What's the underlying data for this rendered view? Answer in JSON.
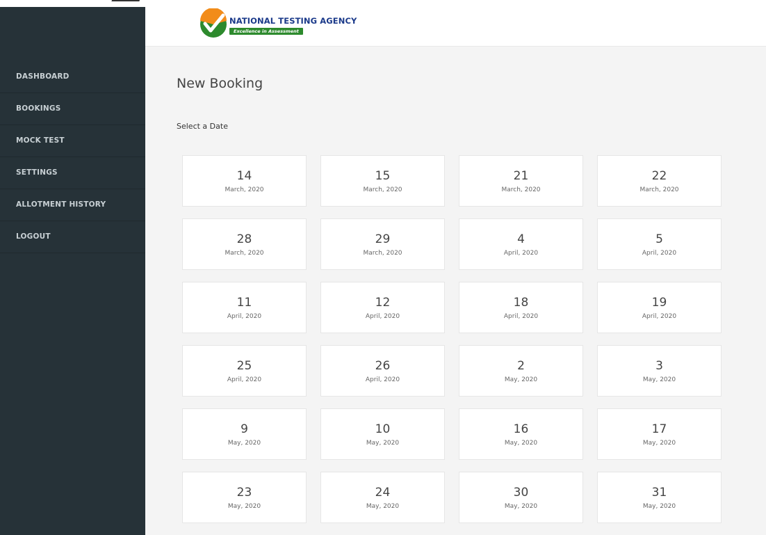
{
  "header": {
    "logo_title": "NATIONAL TESTING AGENCY",
    "logo_tagline": "Excellence in Assessment"
  },
  "sidebar": {
    "items": [
      {
        "label": "DASHBOARD"
      },
      {
        "label": "BOOKINGS"
      },
      {
        "label": "MOCK TEST"
      },
      {
        "label": "SETTINGS"
      },
      {
        "label": "ALLOTMENT HISTORY"
      },
      {
        "label": "LOGOUT"
      }
    ]
  },
  "main": {
    "title": "New Booking",
    "select_label": "Select a Date",
    "dates": [
      {
        "day": "14",
        "month": "March, 2020"
      },
      {
        "day": "15",
        "month": "March, 2020"
      },
      {
        "day": "21",
        "month": "March, 2020"
      },
      {
        "day": "22",
        "month": "March, 2020"
      },
      {
        "day": "28",
        "month": "March, 2020"
      },
      {
        "day": "29",
        "month": "March, 2020"
      },
      {
        "day": "4",
        "month": "April, 2020"
      },
      {
        "day": "5",
        "month": "April, 2020"
      },
      {
        "day": "11",
        "month": "April, 2020"
      },
      {
        "day": "12",
        "month": "April, 2020"
      },
      {
        "day": "18",
        "month": "April, 2020"
      },
      {
        "day": "19",
        "month": "April, 2020"
      },
      {
        "day": "25",
        "month": "April, 2020"
      },
      {
        "day": "26",
        "month": "April, 2020"
      },
      {
        "day": "2",
        "month": "May, 2020"
      },
      {
        "day": "3",
        "month": "May, 2020"
      },
      {
        "day": "9",
        "month": "May, 2020"
      },
      {
        "day": "10",
        "month": "May, 2020"
      },
      {
        "day": "16",
        "month": "May, 2020"
      },
      {
        "day": "17",
        "month": "May, 2020"
      },
      {
        "day": "23",
        "month": "May, 2020"
      },
      {
        "day": "24",
        "month": "May, 2020"
      },
      {
        "day": "30",
        "month": "May, 2020"
      },
      {
        "day": "31",
        "month": "May, 2020"
      }
    ]
  },
  "colors": {
    "sidebar_bg": "#263238",
    "page_bg": "#f4f4f4",
    "logo_blue": "#1b3a8a",
    "logo_green": "#2d8a2d",
    "logo_orange": "#f28c1a"
  }
}
